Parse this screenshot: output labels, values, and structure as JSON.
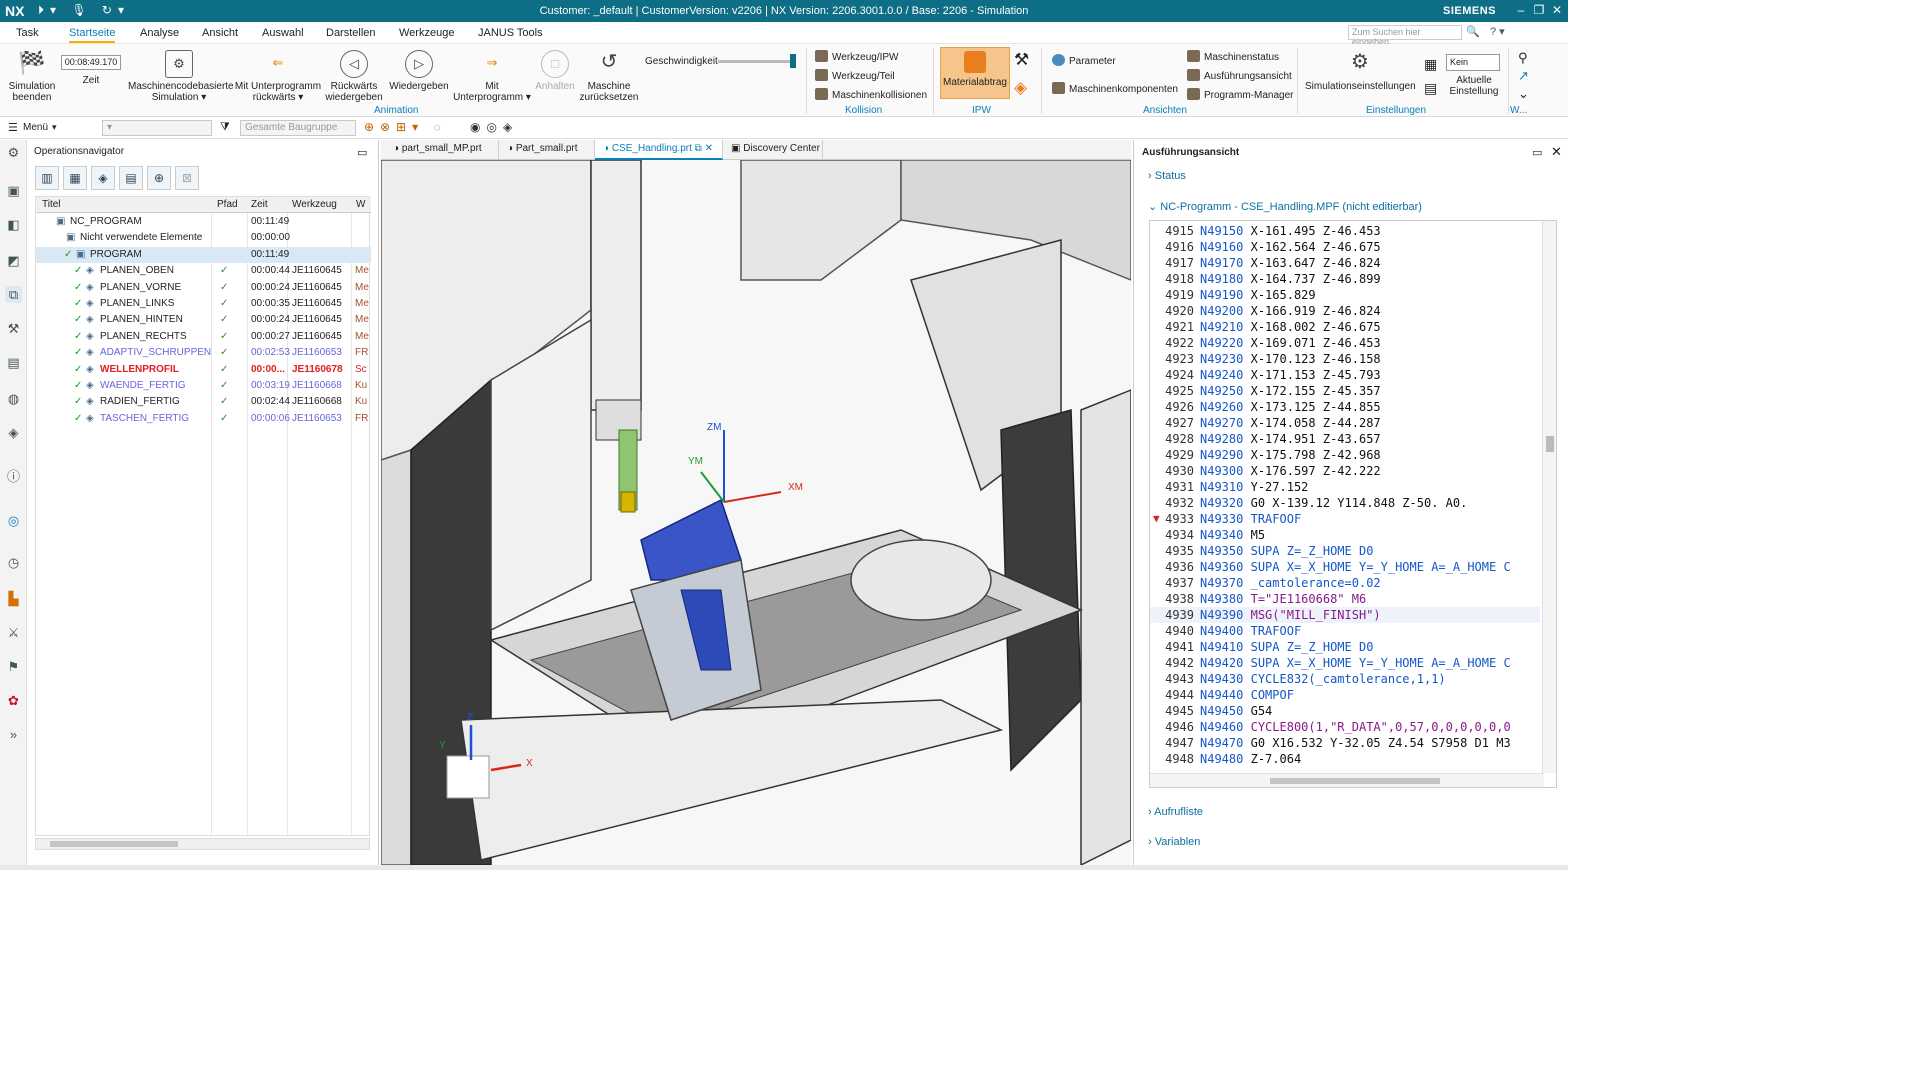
{
  "title_bar": {
    "app": "NX",
    "title": "Customer: _default | CustomerVersion: v2206 | NX Version: 2206.3001.0.0 / Base: 2206 - Simulation",
    "brand": "SIEMENS"
  },
  "menu": {
    "items": [
      "Task",
      "Startseite",
      "Analyse",
      "Ansicht",
      "Auswahl",
      "Darstellen",
      "Werkzeuge",
      "JANUS Tools"
    ],
    "active": "Startseite"
  },
  "search": {
    "placeholder": "Zum Suchen hier eingeben"
  },
  "ribbon": {
    "sim_end": "Simulation beenden",
    "time_value": "00:08:49.170",
    "time_label": "Zeit",
    "maschine_sim": "Maschinencodebasierte Simulation",
    "unterprog_back": "Mit Unterprogramm rückwärts",
    "rueck": "Rückwärts wiedergeben",
    "play": "Wiedergeben",
    "unterprog": "Mit Unterprogramm",
    "halt": "Anhalten",
    "reset": "Maschine zurücksetzen",
    "speed": "Geschwindigkeit",
    "grp_anim": "Animation",
    "wz_ipw": "Werkzeug/IPW",
    "wz_teil": "Werkzeug/Teil",
    "kollisionen": "Maschinenkollisionen",
    "grp_koll": "Kollision",
    "material": "Materialabtrag",
    "grp_ipw": "IPW",
    "parameter": "Parameter",
    "komponenten": "Maschinenkomponenten",
    "status": "Maschinenstatus",
    "ausfuehrung": "Ausführungsansicht",
    "progmgr": "Programm-Manager",
    "grp_ans": "Ansichten",
    "simset": "Simulationseinstellungen",
    "kein": "Kein",
    "aktuelle": "Aktuelle Einstellung",
    "grp_einst": "Einstellungen",
    "w": "W..."
  },
  "toolbar2": {
    "menu": "Menü",
    "assembly": "Gesamte Baugruppe"
  },
  "navigator": {
    "title": "Operationsnavigator",
    "columns": [
      "Titel",
      "Pfad",
      "Zeit",
      "Werkzeug",
      "W"
    ],
    "rows": [
      {
        "name": "NC_PROGRAM",
        "time": "00:11:49",
        "tool": "",
        "w": ""
      },
      {
        "name": "Nicht verwendete Elemente",
        "time": "00:00:00",
        "tool": "",
        "w": ""
      },
      {
        "name": "PROGRAM",
        "time": "00:11:49",
        "tool": "",
        "w": ""
      },
      {
        "name": "PLANEN_OBEN",
        "time": "00:00:44",
        "tool": "JE1160645",
        "w": "Me"
      },
      {
        "name": "PLANEN_VORNE",
        "time": "00:00:24",
        "tool": "JE1160645",
        "w": "Me"
      },
      {
        "name": "PLANEN_LINKS",
        "time": "00:00:35",
        "tool": "JE1160645",
        "w": "Me"
      },
      {
        "name": "PLANEN_HINTEN",
        "time": "00:00:24",
        "tool": "JE1160645",
        "w": "Me"
      },
      {
        "name": "PLANEN_RECHTS",
        "time": "00:00:27",
        "tool": "JE1160645",
        "w": "Me"
      },
      {
        "name": "ADAPTIV_SCHRUPPEN",
        "time": "00:02:53",
        "tool": "JE1160653",
        "w": "FR"
      },
      {
        "name": "WELLENPROFIL",
        "time": "00:00...",
        "tool": "JE1160678",
        "w": "Sc"
      },
      {
        "name": "WAENDE_FERTIG",
        "time": "00:03:19",
        "tool": "JE1160668",
        "w": "Ku"
      },
      {
        "name": "RADIEN_FERTIG",
        "time": "00:02:44",
        "tool": "JE1160668",
        "w": "Ku"
      },
      {
        "name": "TASCHEN_FERTIG",
        "time": "00:00:06",
        "tool": "JE1160653",
        "w": "FR"
      }
    ]
  },
  "tabs": [
    "part_small_MP.prt",
    "Part_small.prt",
    "CSE_Handling.prt",
    "Discovery Center"
  ],
  "viewport": {
    "zm": "ZM",
    "ym": "YM",
    "xm": "XM",
    "x": "X",
    "y": "Y",
    "z": "Z"
  },
  "exec": {
    "title": "Ausführungsansicht",
    "status": "Status",
    "nc_title": "NC-Programm - CSE_Handling.MPF (nicht editierbar)",
    "aufrufliste": "Aufrufliste",
    "variablen": "Variablen",
    "lines": [
      [
        "4915",
        "N49150",
        "X-161.495 Z-46.453"
      ],
      [
        "4916",
        "N49160",
        "X-162.564 Z-46.675"
      ],
      [
        "4917",
        "N49170",
        "X-163.647 Z-46.824"
      ],
      [
        "4918",
        "N49180",
        "X-164.737 Z-46.899"
      ],
      [
        "4919",
        "N49190",
        "X-165.829"
      ],
      [
        "4920",
        "N49200",
        "X-166.919 Z-46.824"
      ],
      [
        "4921",
        "N49210",
        "X-168.002 Z-46.675"
      ],
      [
        "4922",
        "N49220",
        "X-169.071 Z-46.453"
      ],
      [
        "4923",
        "N49230",
        "X-170.123 Z-46.158"
      ],
      [
        "4924",
        "N49240",
        "X-171.153 Z-45.793"
      ],
      [
        "4925",
        "N49250",
        "X-172.155 Z-45.357"
      ],
      [
        "4926",
        "N49260",
        "X-173.125 Z-44.855"
      ],
      [
        "4927",
        "N49270",
        "X-174.058 Z-44.287"
      ],
      [
        "4928",
        "N49280",
        "X-174.951 Z-43.657"
      ],
      [
        "4929",
        "N49290",
        "X-175.798 Z-42.968"
      ],
      [
        "4930",
        "N49300",
        "X-176.597 Z-42.222"
      ],
      [
        "4931",
        "N49310",
        "Y-27.152"
      ],
      [
        "4932",
        "N49320",
        "G0 X-139.12 Y114.848 Z-50. A0."
      ],
      [
        "4933",
        "N49330",
        "TRAFOOF"
      ],
      [
        "4934",
        "N49340",
        "M5"
      ],
      [
        "4935",
        "N49350",
        "SUPA Z=_Z_HOME D0"
      ],
      [
        "4936",
        "N49360",
        "SUPA X=_X_HOME Y=_Y_HOME A=_A_HOME C"
      ],
      [
        "4937",
        "N49370",
        "_camtolerance=0.02"
      ],
      [
        "4938",
        "N49380",
        "T=\"JE1160668\" M6"
      ],
      [
        "4939",
        "N49390",
        "MSG(\"MILL_FINISH\")"
      ],
      [
        "4940",
        "N49400",
        "TRAFOOF"
      ],
      [
        "4941",
        "N49410",
        "SUPA Z=_Z_HOME D0"
      ],
      [
        "4942",
        "N49420",
        "SUPA X=_X_HOME Y=_Y_HOME A=_A_HOME C"
      ],
      [
        "4943",
        "N49430",
        "CYCLE832(_camtolerance,1,1)"
      ],
      [
        "4944",
        "N49440",
        "COMPOF"
      ],
      [
        "4945",
        "N49450",
        "G54"
      ],
      [
        "4946",
        "N49460",
        "CYCLE800(1,\"R_DATA\",0,57,0,0,0,0,0,0"
      ],
      [
        "4947",
        "N49470",
        "G0 X16.532 Y-32.05 Z4.54 S7958 D1 M3"
      ],
      [
        "4948",
        "N49480",
        "Z-7.064"
      ]
    ]
  },
  "colors": {
    "titlebar": "#0d6e85",
    "accent": "#0b7fb8",
    "keyword": "#1556c8",
    "string": "#b8111f",
    "check": "#1a9a1a",
    "error": "#e02020",
    "link_op": "#6666dd"
  }
}
